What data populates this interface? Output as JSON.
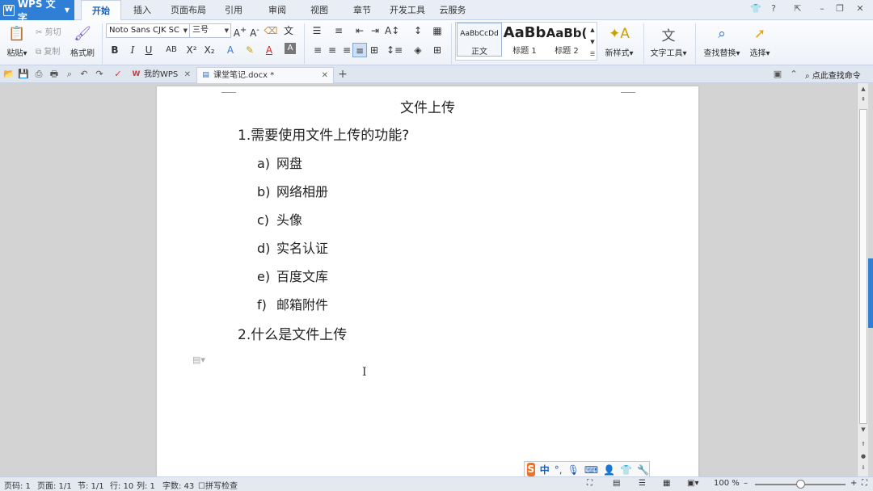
{
  "app": {
    "name": "WPS 文字"
  },
  "menu": {
    "tabs": [
      "开始",
      "插入",
      "页面布局",
      "引用",
      "审阅",
      "视图",
      "章节",
      "开发工具",
      "云服务"
    ],
    "active": "开始"
  },
  "ribbon": {
    "paste_label": "粘贴",
    "cut_label": "剪切",
    "copy_label": "复制",
    "format_painter_label": "格式刷",
    "font_name": "Noto Sans CJK SC",
    "font_size": "三号",
    "styles": [
      {
        "sample": "AaBbCcDd",
        "label": "正文"
      },
      {
        "sample": "AaBb",
        "label": "标题 1"
      },
      {
        "sample": "AaBb(",
        "label": "标题 2"
      }
    ],
    "new_style_label": "新样式",
    "text_tools_label": "文字工具",
    "find_replace_label": "查找替换",
    "select_label": "选择"
  },
  "tabs": {
    "my_wps": "我的WPS",
    "document": "课堂笔记.docx *",
    "search_command": "点此查找命令"
  },
  "document": {
    "title": "文件上传",
    "question1": "1.需要使用文件上传的功能?",
    "options": [
      {
        "letter": "a)",
        "text": "网盘"
      },
      {
        "letter": "b)",
        "text": "网络相册"
      },
      {
        "letter": "c)",
        "text": "头像"
      },
      {
        "letter": "d)",
        "text": "实名认证"
      },
      {
        "letter": "e)",
        "text": "百度文库"
      },
      {
        "letter": "f)",
        "text": "邮箱附件"
      }
    ],
    "question2": "2.什么是文件上传"
  },
  "ime": {
    "mode": "中"
  },
  "status": {
    "page_code": "页码: 1",
    "page": "页面: 1/1",
    "section": "节: 1/1",
    "row": "行: 10",
    "col": "列: 1",
    "word_count": "字数: 43",
    "spell_check": "拼写检查",
    "zoom": "100 %",
    "zoom_fraction": 0.5
  }
}
